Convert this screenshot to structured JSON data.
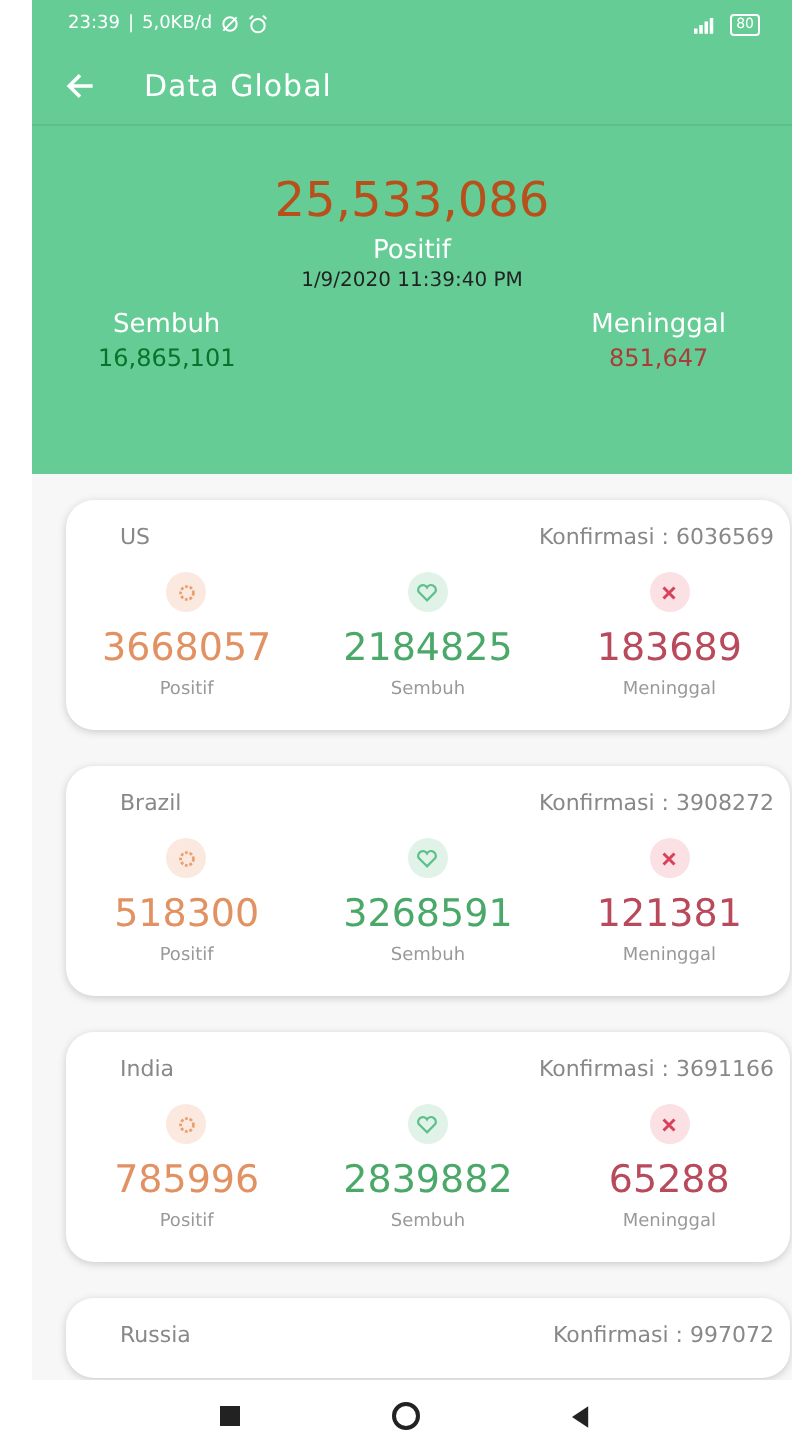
{
  "status_bar": {
    "time": "23:39",
    "separator": "|",
    "speed": "5,0KB/d",
    "battery": "80"
  },
  "toolbar": {
    "title": "Data Global"
  },
  "global": {
    "positive": "25,533,086",
    "positive_label": "Positif",
    "updated": "1/9/2020 11:39:40 PM",
    "recovered_label": "Sembuh",
    "recovered": "16,865,101",
    "deaths_label": "Meninggal",
    "deaths": "851,647"
  },
  "countries": [
    {
      "name": "US",
      "confirmed": "Konfirmasi : 6036569",
      "stats": [
        {
          "kind": "positive",
          "value": "3668057",
          "label": "Positif"
        },
        {
          "kind": "recovered",
          "value": "2184825",
          "label": "Sembuh"
        },
        {
          "kind": "deaths",
          "value": "183689",
          "label": "Meninggal"
        }
      ]
    },
    {
      "name": "Brazil",
      "confirmed": "Konfirmasi : 3908272",
      "stats": [
        {
          "kind": "positive",
          "value": "518300",
          "label": "Positif"
        },
        {
          "kind": "recovered",
          "value": "3268591",
          "label": "Sembuh"
        },
        {
          "kind": "deaths",
          "value": "121381",
          "label": "Meninggal"
        }
      ]
    },
    {
      "name": "India",
      "confirmed": "Konfirmasi : 3691166",
      "stats": [
        {
          "kind": "positive",
          "value": "785996",
          "label": "Positif"
        },
        {
          "kind": "recovered",
          "value": "2839882",
          "label": "Sembuh"
        },
        {
          "kind": "deaths",
          "value": "65288",
          "label": "Meninggal"
        }
      ]
    },
    {
      "name": "Russia",
      "confirmed": "Konfirmasi : 997072"
    }
  ]
}
